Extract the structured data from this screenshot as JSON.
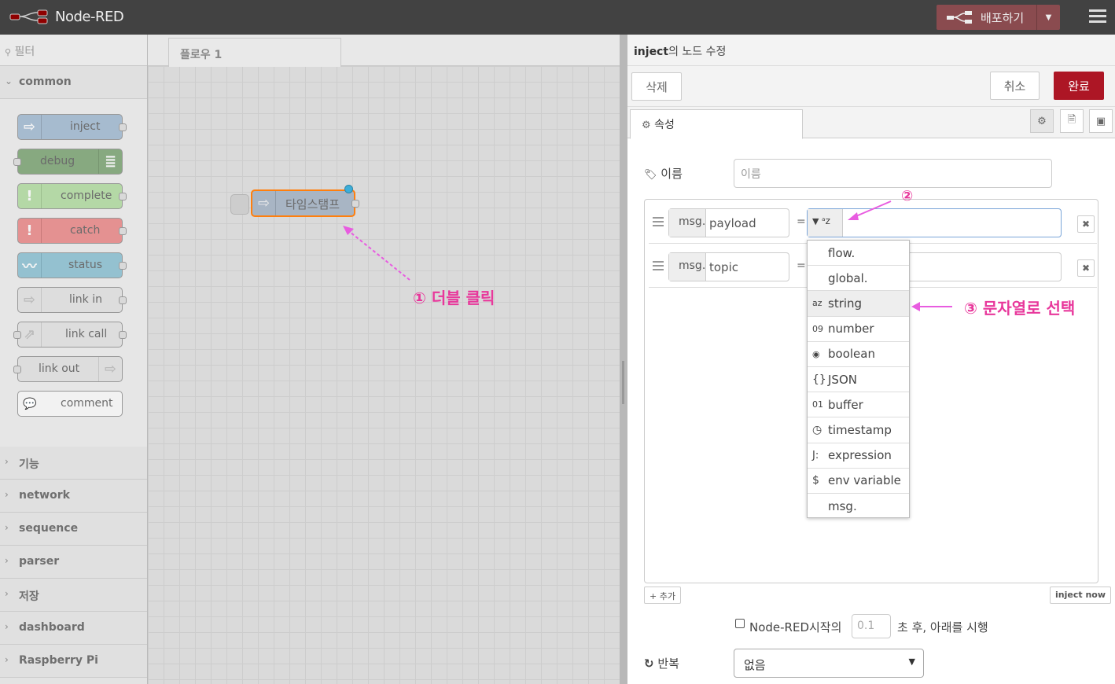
{
  "header": {
    "app_title": "Node-RED",
    "deploy_label": "배포하기"
  },
  "palette": {
    "filter_placeholder": "필터",
    "open_category": "common",
    "nodes": [
      {
        "label": "inject",
        "color": "#a6bbcf",
        "icon": "arrow-icon"
      },
      {
        "label": "debug",
        "color": "#87a980",
        "icon": "list-icon"
      },
      {
        "label": "complete",
        "color": "#c0deed",
        "icon": "exclamation-icon"
      },
      {
        "label": "catch",
        "color": "#e49191",
        "icon": "exclamation-icon"
      },
      {
        "label": "status",
        "color": "#94c1d0",
        "icon": "pulse-icon"
      },
      {
        "label": "link in",
        "color": "#dddddd",
        "icon": "link-in-icon"
      },
      {
        "label": "link call",
        "color": "#dddddd",
        "icon": "link-call-icon"
      },
      {
        "label": "link out",
        "color": "#dddddd",
        "icon": "link-out-icon"
      },
      {
        "label": "comment",
        "color": "#ffffff",
        "icon": "comment-icon"
      }
    ],
    "categories": [
      "기능",
      "network",
      "sequence",
      "parser",
      "저장",
      "dashboard",
      "Raspberry Pi"
    ]
  },
  "workspace": {
    "tab_label": "플로우 1",
    "node_label": "타임스탬프",
    "annotation1": "① 더블 클릭",
    "annotation2": "②",
    "annotation3": "③ 문자열로 선택"
  },
  "tray": {
    "title_bold": "inject",
    "title_rest": "의 노드 수정",
    "delete_label": "삭제",
    "cancel_label": "취소",
    "done_label": "완료",
    "props_tab": "속성",
    "name_label": "이름",
    "name_placeholder": "이름",
    "rows": [
      {
        "prefix": "msg.",
        "property": "payload",
        "eq": "="
      },
      {
        "prefix": "msg.",
        "property": "topic",
        "eq": "="
      }
    ],
    "type_menu": [
      {
        "icon": "",
        "label": "flow."
      },
      {
        "icon": "",
        "label": "global."
      },
      {
        "icon": "az",
        "label": "string"
      },
      {
        "icon": "09",
        "label": "number"
      },
      {
        "icon": "◉",
        "label": "boolean"
      },
      {
        "icon": "{}",
        "label": "JSON"
      },
      {
        "icon": "01",
        "label": "buffer"
      },
      {
        "icon": "◷",
        "label": "timestamp"
      },
      {
        "icon": "J:",
        "label": "expression"
      },
      {
        "icon": "$",
        "label": "env variable"
      },
      {
        "icon": "",
        "label": "msg."
      }
    ],
    "add_label": "+ 추가",
    "inject_now_label": "inject now",
    "startup_label_pre": "Node-RED시작의",
    "startup_value": "0.1",
    "startup_label_post": "초 후, 아래를 시행",
    "repeat_label": "반복",
    "repeat_value": "없음"
  }
}
